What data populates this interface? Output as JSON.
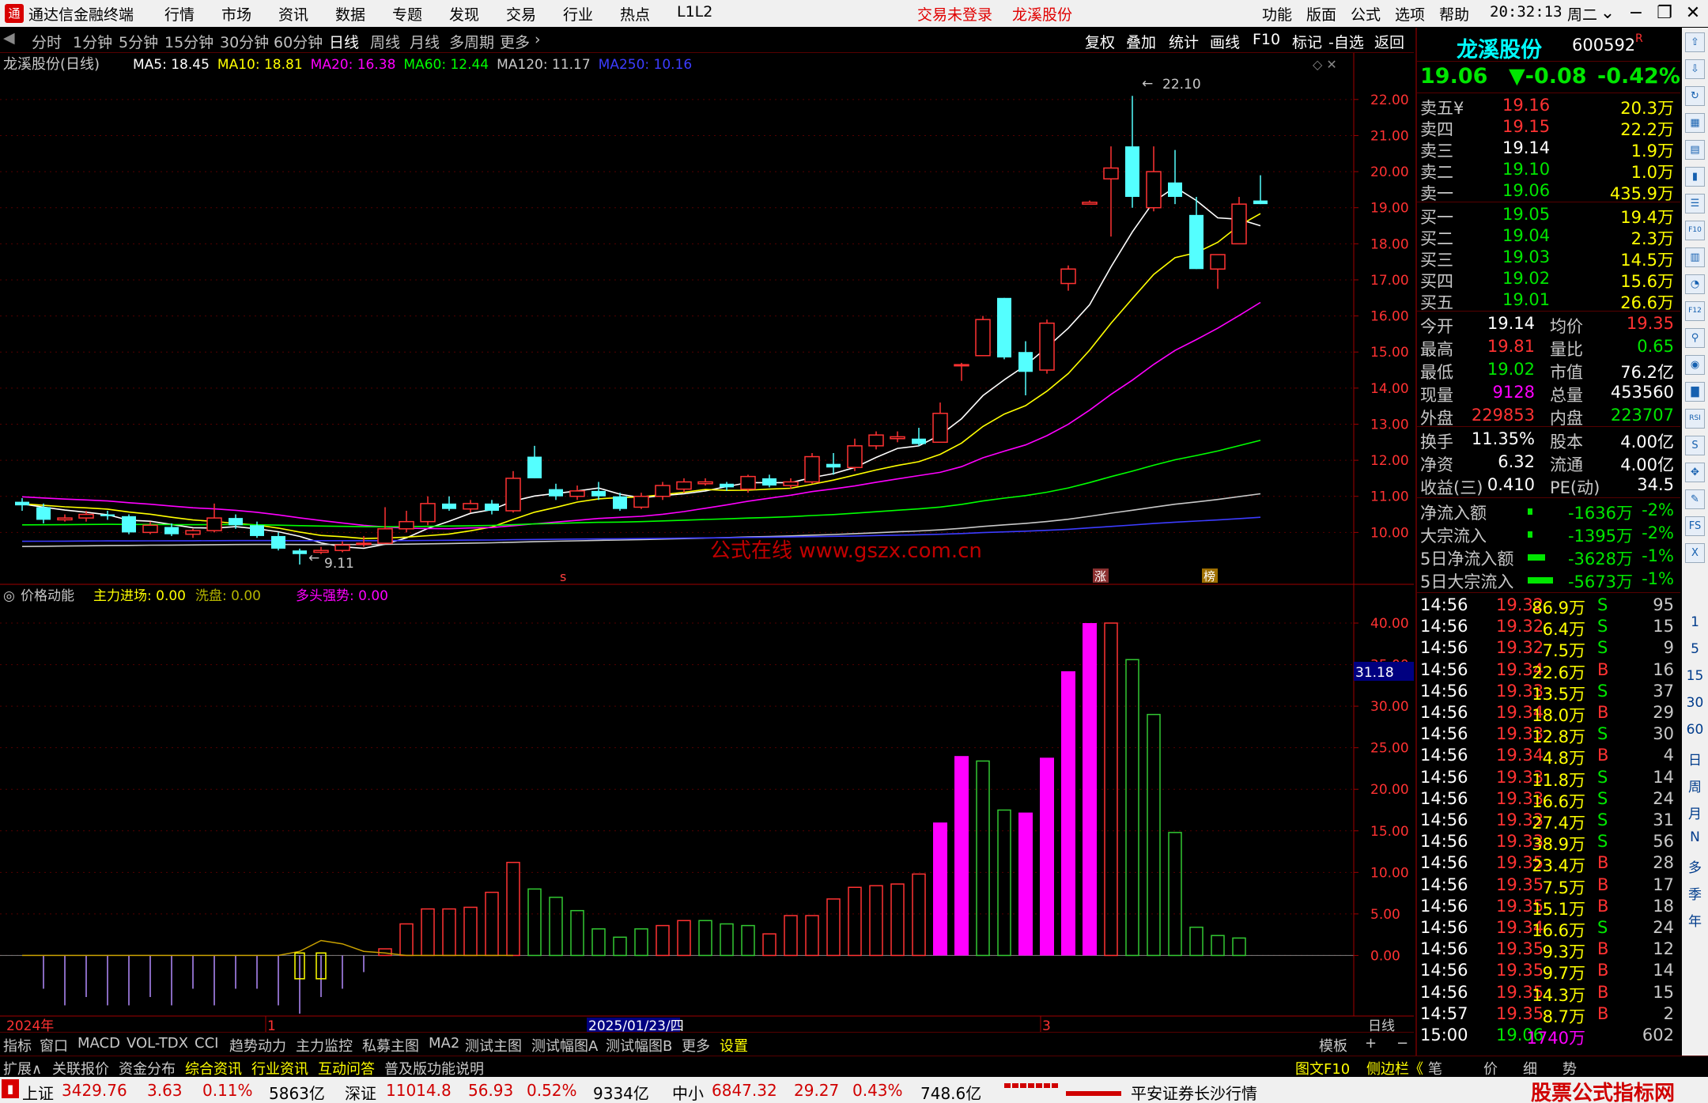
{
  "menu": {
    "app_title": "通达信金融终端",
    "items": [
      "行情",
      "市场",
      "资讯",
      "数据",
      "专题",
      "发现",
      "交易",
      "行业",
      "热点",
      "L1L2"
    ],
    "trade_status": "交易未登录",
    "stock_name": "龙溪股份",
    "right_items": [
      "功能",
      "版面",
      "公式",
      "选项",
      "帮助"
    ],
    "time": "20:32:13",
    "weekday": "周二"
  },
  "periods": {
    "tabs": [
      "分时",
      "1分钟",
      "5分钟",
      "15分钟",
      "30分钟",
      "60分钟",
      "日线",
      "周线",
      "月线",
      "多周期",
      "更多"
    ],
    "active": "日线",
    "right_tabs": [
      "复权",
      "叠加",
      "统计",
      "画线",
      "F10",
      "标记",
      "-自选",
      "返回"
    ]
  },
  "main_chart": {
    "title": "龙溪股份(日线)",
    "ma": [
      {
        "label": "MA5: 18.45",
        "color": "#ffffff"
      },
      {
        "label": "MA10: 18.81",
        "color": "#ffff00"
      },
      {
        "label": "MA20: 16.38",
        "color": "#ff00ff"
      },
      {
        "label": "MA60: 12.44",
        "color": "#00ff00"
      },
      {
        "label": "MA120: 11.17",
        "color": "#c8c8c8"
      },
      {
        "label": "MA250: 10.16",
        "color": "#3c3cff"
      }
    ],
    "high_label": "22.10",
    "low_label": "9.11",
    "watermark": "公式在线  www.gszx.com.cn",
    "markers": [
      "s",
      "涨",
      "榜"
    ]
  },
  "indicator": {
    "name": "价格动能",
    "lines": [
      {
        "label": "主力进场: 0.00",
        "color": "#ffff00"
      },
      {
        "label": "洗盘: 0.00",
        "color": "#b4b400"
      },
      {
        "label": "多头强势: 0.00",
        "color": "#ff00ff"
      }
    ],
    "cursor_value": "31.18"
  },
  "x_axis": {
    "labels": [
      "2024年",
      "1",
      "2025/01/23/四",
      "3"
    ],
    "right_label": "日线"
  },
  "chart_data": [
    {
      "type": "candlestick",
      "title": "龙溪股份(日线)",
      "ylim": [
        9.0,
        22.5
      ],
      "yticks": [
        "22.00",
        "21.00",
        "20.00",
        "19.00",
        "18.00",
        "17.00",
        "16.00",
        "15.00",
        "14.00",
        "13.00",
        "12.00",
        "11.00",
        "10.00"
      ],
      "candles": [
        [
          10.85,
          10.75,
          10.95,
          10.6
        ],
        [
          10.7,
          10.35,
          10.8,
          10.25
        ],
        [
          10.35,
          10.4,
          10.5,
          10.3
        ],
        [
          10.4,
          10.5,
          10.6,
          10.3
        ],
        [
          10.5,
          10.45,
          10.6,
          10.35
        ],
        [
          10.45,
          10.0,
          10.5,
          9.95
        ],
        [
          10.0,
          10.2,
          10.3,
          9.95
        ],
        [
          10.15,
          9.95,
          10.25,
          9.9
        ],
        [
          9.95,
          10.05,
          10.1,
          9.85
        ],
        [
          10.05,
          10.4,
          10.8,
          10.0
        ],
        [
          10.4,
          10.2,
          10.5,
          10.1
        ],
        [
          10.2,
          9.9,
          10.3,
          9.85
        ],
        [
          9.9,
          9.55,
          10.0,
          9.5
        ],
        [
          9.5,
          9.4,
          9.55,
          9.11
        ],
        [
          9.45,
          9.5,
          9.6,
          9.4
        ],
        [
          9.5,
          9.65,
          9.75,
          9.45
        ],
        [
          9.7,
          9.7,
          9.9,
          9.6
        ],
        [
          9.7,
          10.1,
          10.7,
          9.7
        ],
        [
          10.1,
          10.3,
          10.6,
          10.0
        ],
        [
          10.3,
          10.8,
          11.0,
          10.2
        ],
        [
          10.8,
          10.65,
          11.0,
          10.6
        ],
        [
          10.65,
          10.8,
          10.9,
          10.55
        ],
        [
          10.8,
          10.6,
          10.9,
          10.5
        ],
        [
          10.6,
          11.5,
          11.7,
          10.55
        ],
        [
          12.1,
          11.5,
          12.4,
          11.5
        ],
        [
          11.2,
          11.0,
          11.35,
          10.9
        ],
        [
          11.0,
          11.15,
          11.3,
          10.9
        ],
        [
          11.15,
          11.0,
          11.4,
          10.9
        ],
        [
          11.0,
          10.65,
          11.1,
          10.6
        ],
        [
          10.7,
          11.0,
          11.1,
          10.65
        ],
        [
          11.0,
          11.3,
          11.4,
          10.9
        ],
        [
          11.2,
          11.4,
          11.5,
          11.1
        ],
        [
          11.35,
          11.4,
          11.5,
          11.3
        ],
        [
          11.35,
          11.25,
          11.4,
          11.15
        ],
        [
          11.2,
          11.55,
          11.6,
          11.1
        ],
        [
          11.5,
          11.3,
          11.6,
          11.25
        ],
        [
          11.3,
          11.4,
          11.5,
          11.2
        ],
        [
          11.4,
          12.1,
          12.2,
          11.35
        ],
        [
          11.9,
          11.8,
          12.2,
          11.6
        ],
        [
          11.8,
          12.4,
          12.6,
          11.7
        ],
        [
          12.4,
          12.7,
          12.8,
          12.3
        ],
        [
          12.6,
          12.65,
          12.8,
          12.5
        ],
        [
          12.6,
          12.45,
          12.9,
          12.4
        ],
        [
          12.5,
          13.3,
          13.6,
          12.5
        ],
        [
          14.65,
          14.65,
          14.7,
          14.2
        ],
        [
          14.9,
          15.9,
          16.0,
          14.9
        ],
        [
          16.5,
          14.85,
          16.5,
          14.8
        ],
        [
          15.0,
          14.45,
          15.3,
          13.8
        ],
        [
          14.5,
          15.8,
          15.9,
          14.4
        ],
        [
          16.9,
          17.3,
          17.4,
          16.7
        ],
        [
          19.1,
          19.15,
          19.2,
          19.1
        ],
        [
          19.8,
          20.1,
          20.7,
          18.2
        ],
        [
          20.7,
          19.3,
          22.1,
          19.0
        ],
        [
          19.0,
          20.0,
          20.7,
          18.9
        ],
        [
          19.7,
          19.3,
          20.6,
          19.1
        ],
        [
          18.8,
          17.3,
          19.3,
          17.3
        ],
        [
          17.3,
          17.7,
          17.7,
          16.75
        ],
        [
          18.0,
          19.1,
          19.3,
          18.0
        ],
        [
          19.2,
          19.1,
          19.9,
          19.1
        ]
      ]
    },
    {
      "type": "bar",
      "title": "价格动能",
      "ylim": [
        -7.0,
        42.0
      ],
      "yticks": [
        "40.00",
        "35.00",
        "30.00",
        "25.00",
        "20.00",
        "15.00",
        "10.00",
        "5.00",
        "0.00"
      ],
      "values": [
        0,
        -4,
        -6,
        -5,
        -6,
        -6,
        -5,
        -6,
        -4,
        -6,
        -4,
        -4,
        -6,
        -7,
        -5,
        -4,
        -2,
        0.8,
        3.8,
        5.6,
        5.6,
        5.8,
        7.6,
        11.2,
        8,
        7,
        5.4,
        3.2,
        2.2,
        3.2,
        3.6,
        4.2,
        4.2,
        3.8,
        3.6,
        2.6,
        4.8,
        4.8,
        6.8,
        8.2,
        8.4,
        8.6,
        9.8,
        16,
        24,
        23.4,
        17.5,
        17.2,
        23.8,
        34.2,
        40,
        40,
        35.6,
        29,
        14.8,
        3.4,
        2.4,
        2.1
      ],
      "colors": [
        "p",
        "p",
        "p",
        "p",
        "p",
        "p",
        "p",
        "p",
        "p",
        "p",
        "p",
        "p",
        "p",
        "p",
        "p",
        "p",
        "p",
        "r",
        "r",
        "r",
        "r",
        "r",
        "r",
        "r",
        "g",
        "g",
        "g",
        "g",
        "g",
        "g",
        "r",
        "r",
        "g",
        "g",
        "g",
        "r",
        "r",
        "r",
        "r",
        "r",
        "r",
        "r",
        "r",
        "m",
        "m",
        "g",
        "g",
        "m",
        "m",
        "m",
        "m",
        "r",
        "g",
        "g",
        "g",
        "g",
        "g",
        "g"
      ],
      "overlay_line": [
        0,
        0,
        0,
        0,
        0,
        0,
        0,
        0,
        0,
        0,
        0,
        0,
        0,
        0.5,
        1.8,
        1.4,
        0.5,
        0.3,
        0,
        0,
        0,
        0,
        0,
        0
      ]
    }
  ],
  "quote": {
    "name": "龙溪股份",
    "code": "600592",
    "flag": "R",
    "price": "19.06",
    "change": "▼-0.08",
    "change_pct": "-0.42%",
    "asks": [
      {
        "label": "卖五",
        "mark": "¥",
        "price": "19.16",
        "vol": "20.3万"
      },
      {
        "label": "卖四",
        "mark": "",
        "price": "19.15",
        "vol": "22.2万"
      },
      {
        "label": "卖三",
        "mark": "",
        "price": "19.14",
        "vol": "1.9万"
      },
      {
        "label": "卖二",
        "mark": "",
        "price": "19.10",
        "vol": "1.0万"
      },
      {
        "label": "卖一",
        "mark": "",
        "price": "19.06",
        "vol": "435.9万"
      }
    ],
    "bids": [
      {
        "label": "买一",
        "price": "19.05",
        "vol": "19.4万"
      },
      {
        "label": "买二",
        "price": "19.04",
        "vol": "2.3万"
      },
      {
        "label": "买三",
        "price": "19.03",
        "vol": "14.5万"
      },
      {
        "label": "买四",
        "price": "19.02",
        "vol": "15.6万"
      },
      {
        "label": "买五",
        "price": "19.01",
        "vol": "26.6万"
      }
    ],
    "stats1": [
      {
        "l1": "今开",
        "v1": "19.14",
        "c1": "#ffffff",
        "l2": "均价",
        "v2": "19.35",
        "c2": "#ff3232"
      },
      {
        "l1": "最高",
        "v1": "19.81",
        "c1": "#ff3232",
        "l2": "量比",
        "v2": "0.65",
        "c2": "#00e600"
      },
      {
        "l1": "最低",
        "v1": "19.02",
        "c1": "#00e600",
        "l2": "市值",
        "v2": "76.2亿",
        "c2": "#ffffff"
      },
      {
        "l1": "现量",
        "v1": "9128",
        "c1": "#ff00ff",
        "l2": "总量",
        "v2": "453560",
        "c2": "#ffffff"
      },
      {
        "l1": "外盘",
        "v1": "229853",
        "c1": "#ff3232",
        "l2": "内盘",
        "v2": "223707",
        "c2": "#00e600"
      }
    ],
    "stats2": [
      {
        "l1": "换手",
        "v1": "11.35%",
        "l2": "股本",
        "v2": "4.00亿"
      },
      {
        "l1": "净资",
        "v1": "6.32",
        "l2": "流通",
        "v2": "4.00亿"
      },
      {
        "l1": "收益(三)",
        "v1": "0.410",
        "l2": "PE(动)",
        "v2": "34.5"
      }
    ],
    "flows": [
      {
        "label": "净流入额",
        "val": "-1636万",
        "pct": "-2%",
        "bar": 6
      },
      {
        "label": "大宗流入",
        "val": "-1395万",
        "pct": "-2%",
        "bar": 6
      },
      {
        "label": "5日净流入额",
        "val": "-3628万",
        "pct": "-1%",
        "bar": 22
      },
      {
        "label": "5日大宗流入",
        "val": "-5673万",
        "pct": "-1%",
        "bar": 32
      }
    ],
    "ticks": [
      {
        "t": "14:56",
        "p": "19.32",
        "v": "86.9万",
        "s": "S",
        "n": "95"
      },
      {
        "t": "14:56",
        "p": "19.32",
        "v": "6.4万",
        "s": "S",
        "n": "15"
      },
      {
        "t": "14:56",
        "p": "19.32",
        "v": "7.5万",
        "s": "S",
        "n": "9"
      },
      {
        "t": "14:56",
        "p": "19.34",
        "v": "22.6万",
        "s": "B",
        "n": "16"
      },
      {
        "t": "14:56",
        "p": "19.33",
        "v": "13.5万",
        "s": "S",
        "n": "37"
      },
      {
        "t": "14:56",
        "p": "19.34",
        "v": "18.0万",
        "s": "B",
        "n": "29"
      },
      {
        "t": "14:56",
        "p": "19.33",
        "v": "12.8万",
        "s": "S",
        "n": "30"
      },
      {
        "t": "14:56",
        "p": "19.34",
        "v": "4.8万",
        "s": "B",
        "n": "4"
      },
      {
        "t": "14:56",
        "p": "19.33",
        "v": "11.8万",
        "s": "S",
        "n": "14"
      },
      {
        "t": "14:56",
        "p": "19.33",
        "v": "16.6万",
        "s": "S",
        "n": "24"
      },
      {
        "t": "14:56",
        "p": "19.33",
        "v": "27.4万",
        "s": "S",
        "n": "31"
      },
      {
        "t": "14:56",
        "p": "19.33",
        "v": "38.9万",
        "s": "S",
        "n": "56"
      },
      {
        "t": "14:56",
        "p": "19.35",
        "v": "23.4万",
        "s": "B",
        "n": "28"
      },
      {
        "t": "14:56",
        "p": "19.35",
        "v": "7.5万",
        "s": "B",
        "n": "17"
      },
      {
        "t": "14:56",
        "p": "19.35",
        "v": "15.1万",
        "s": "B",
        "n": "18"
      },
      {
        "t": "14:56",
        "p": "19.34",
        "v": "16.6万",
        "s": "S",
        "n": "24"
      },
      {
        "t": "14:56",
        "p": "19.35",
        "v": "9.3万",
        "s": "B",
        "n": "12"
      },
      {
        "t": "14:56",
        "p": "19.35",
        "v": "9.7万",
        "s": "B",
        "n": "14"
      },
      {
        "t": "14:56",
        "p": "19.35",
        "v": "14.3万",
        "s": "B",
        "n": "15"
      },
      {
        "t": "14:57",
        "p": "19.35",
        "v": "8.7万",
        "s": "B",
        "n": "2"
      },
      {
        "t": "15:00",
        "p": "19.06",
        "v": "1740万",
        "s": "",
        "n": "602"
      }
    ],
    "tabs": [
      "笔",
      "价",
      "细",
      "势"
    ]
  },
  "side_tools": {
    "icons": [
      "up-arrow",
      "down-arrow",
      "refresh",
      "grid",
      "chart",
      "candles",
      "list",
      "f10",
      "news",
      "pie",
      "f12",
      "link",
      "circle",
      "bar",
      "rsi",
      "s",
      "move",
      "pen",
      "fs",
      "excel"
    ],
    "periods": [
      "1",
      "5",
      "15",
      "30",
      "60",
      "日",
      "周",
      "月",
      "N",
      "多",
      "季",
      "年"
    ]
  },
  "indicator_tabs": [
    "指标",
    "窗口",
    "MACD",
    "VOL-TDX",
    "CCI",
    "趋势动力",
    "主力监控",
    "私募主图",
    "MA2",
    "测试主图",
    "测试幅图A",
    "测试幅图B",
    "更多",
    "设置",
    "模板",
    "+",
    "−"
  ],
  "info_tabs": [
    "扩展∧",
    "关联报价",
    "资金分布",
    "综合资讯",
    "行业资讯",
    "互动问答",
    "普及版功能说明"
  ],
  "info_right": [
    "图文F10",
    "侧边栏《"
  ],
  "status": [
    {
      "name": "上证",
      "val": "3429.76",
      "chg": "3.63",
      "pct": "0.11%",
      "amt": "5863亿"
    },
    {
      "name": "深证",
      "val": "11014.8",
      "chg": "56.93",
      "pct": "0.52%",
      "amt": "9334亿"
    },
    {
      "name": "中小",
      "val": "6847.32",
      "chg": "29.27",
      "pct": "0.43%",
      "amt": "748.6亿"
    }
  ],
  "broker": "平安证券长沙行情",
  "corner_logo": {
    "title": "股票公式指标网",
    "url": "www.gszx.com.cn"
  }
}
